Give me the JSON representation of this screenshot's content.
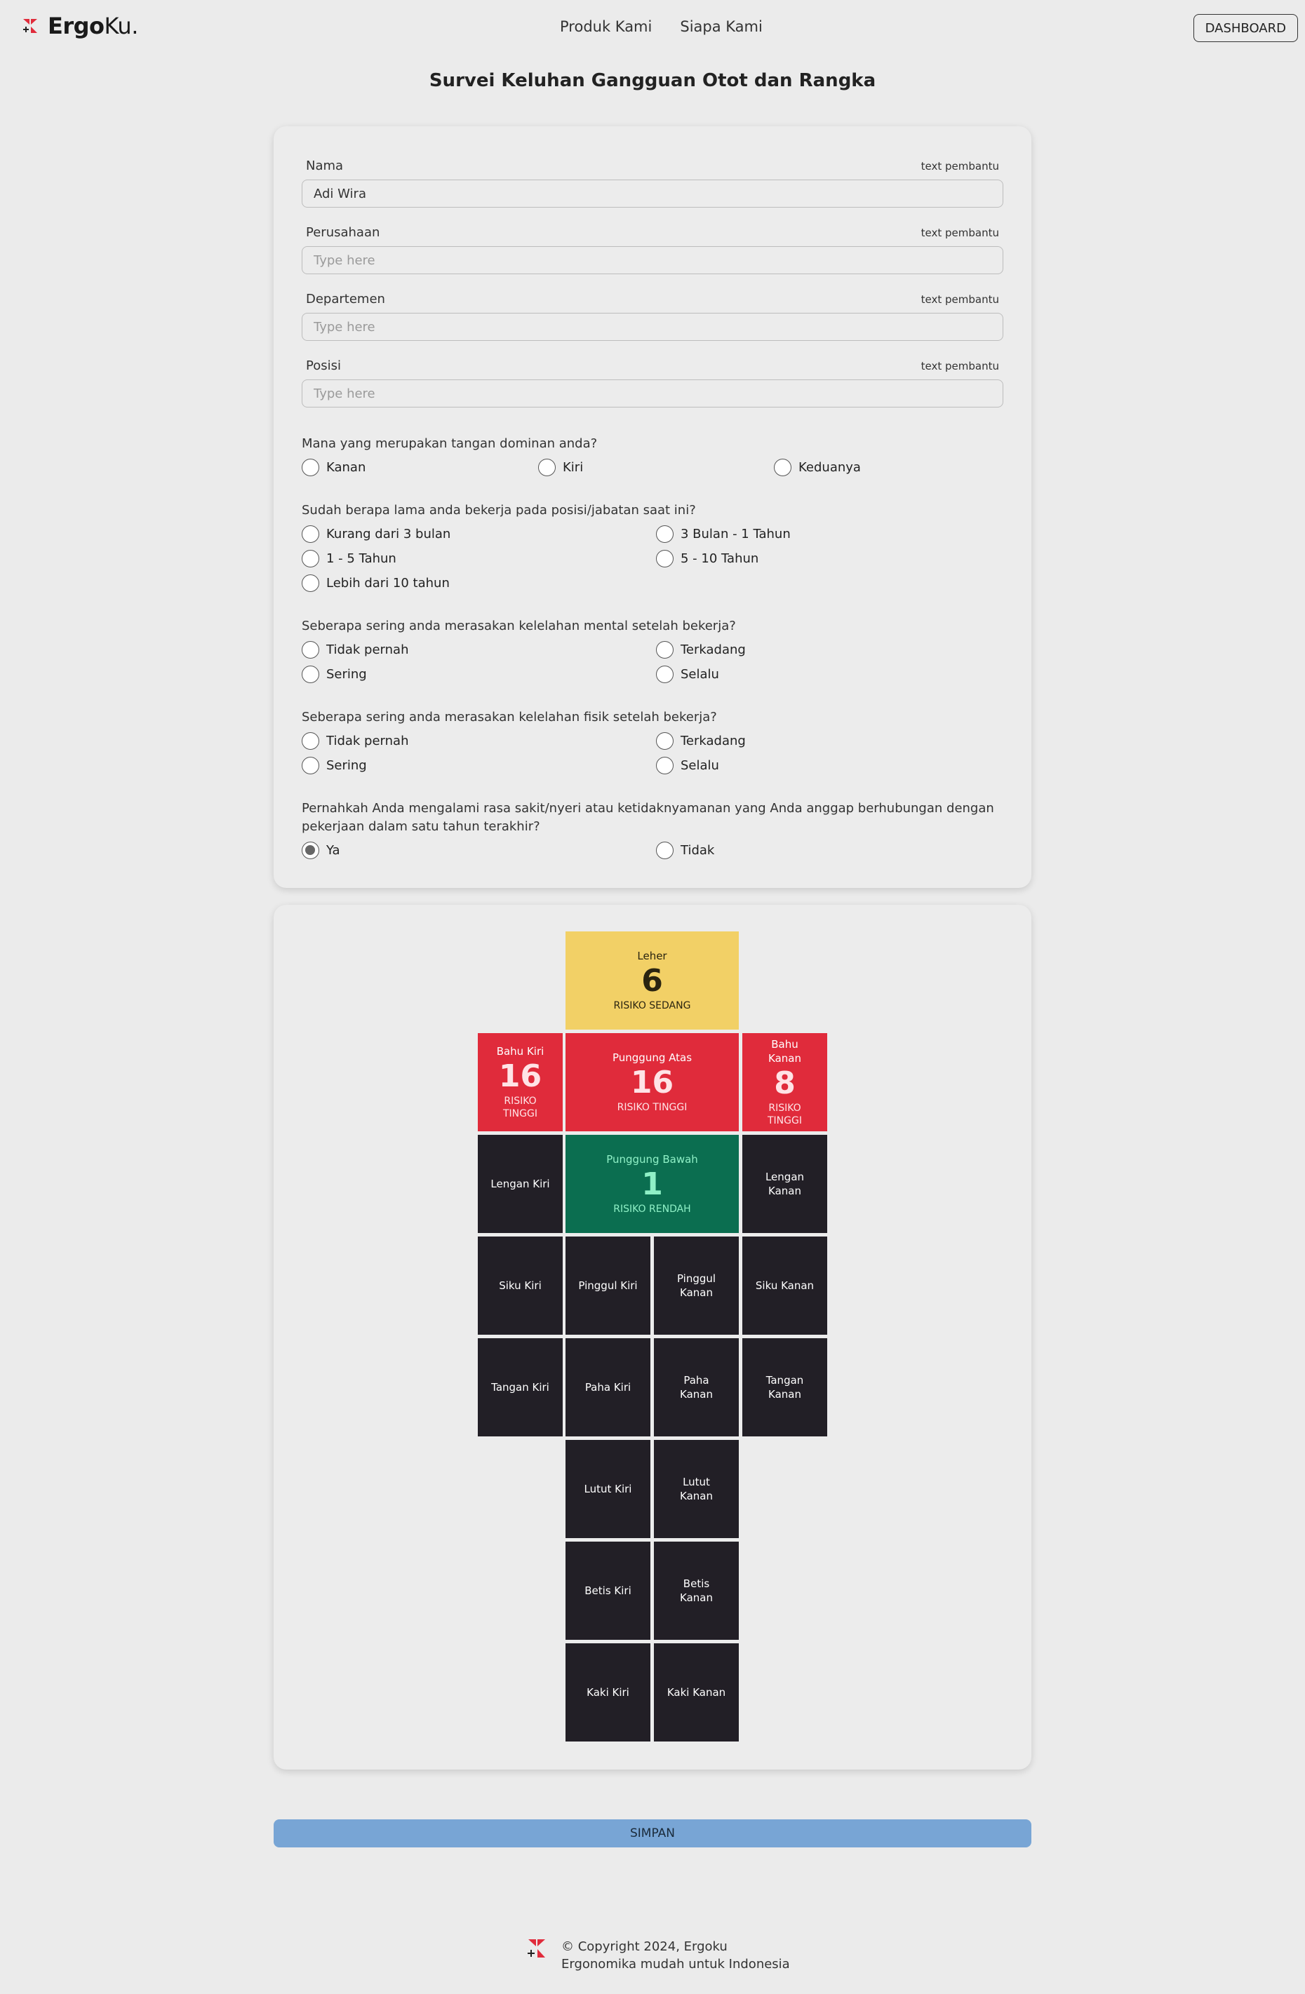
{
  "header": {
    "logo_bold": "Ergo",
    "logo_light": "Ku.",
    "nav": [
      "Produk Kami",
      "Siapa Kami"
    ],
    "dashboard_label": "DASHBOARD"
  },
  "title": "Survei Keluhan Gangguan Otot dan Rangka",
  "form": {
    "fields": [
      {
        "label": "Nama",
        "help": "text pembantu",
        "value": "Adi Wira",
        "placeholder": "Type here"
      },
      {
        "label": "Perusahaan",
        "help": "text pembantu",
        "value": "",
        "placeholder": "Type here"
      },
      {
        "label": "Departemen",
        "help": "text pembantu",
        "value": "",
        "placeholder": "Type here"
      },
      {
        "label": "Posisi",
        "help": "text pembantu",
        "value": "",
        "placeholder": "Type here"
      }
    ],
    "questions": [
      {
        "text": "Mana yang merupakan tangan dominan anda?",
        "options": [
          "Kanan",
          "Kiri",
          "Keduanya"
        ],
        "selected": null
      },
      {
        "text": "Sudah berapa lama anda bekerja pada posisi/jabatan saat ini?",
        "options": [
          "Kurang dari 3 bulan",
          "3 Bulan - 1 Tahun",
          "1 - 5 Tahun",
          "5 - 10 Tahun",
          "Lebih dari 10 tahun"
        ],
        "selected": null
      },
      {
        "text": "Seberapa sering anda merasakan kelelahan mental setelah bekerja?",
        "options": [
          "Tidak pernah",
          "Terkadang",
          "Sering",
          "Selalu"
        ],
        "selected": null
      },
      {
        "text": "Seberapa sering anda merasakan kelelahan fisik setelah bekerja?",
        "options": [
          "Tidak pernah",
          "Terkadang",
          "Sering",
          "Selalu"
        ],
        "selected": null
      },
      {
        "text": "Pernahkah Anda mengalami rasa sakit/nyeri atau ketidaknyamanan yang Anda anggap berhubungan dengan pekerjaan dalam satu tahun terakhir?",
        "options": [
          "Ya",
          "Tidak"
        ],
        "selected": "Ya"
      }
    ]
  },
  "body_map": {
    "cells": [
      {
        "name": "Leher",
        "score": "6",
        "risk": "RISIKO SEDANG",
        "level": "yellow"
      },
      {
        "name": "Bahu Kiri",
        "score": "16",
        "risk": "RISIKO TINGGI",
        "level": "red"
      },
      {
        "name": "Punggung Atas",
        "score": "16",
        "risk": "RISIKO TINGGI",
        "level": "red"
      },
      {
        "name": "Bahu Kanan",
        "score": "8",
        "risk": "RISIKO TINGGI",
        "level": "red"
      },
      {
        "name": "Lengan Kiri",
        "score": "",
        "risk": "",
        "level": "none"
      },
      {
        "name": "Punggung Bawah",
        "score": "1",
        "risk": "RISIKO RENDAH",
        "level": "green"
      },
      {
        "name": "Lengan Kanan",
        "score": "",
        "risk": "",
        "level": "none"
      },
      {
        "name": "Siku Kiri",
        "score": "",
        "risk": "",
        "level": "none"
      },
      {
        "name": "Pinggul Kiri",
        "score": "",
        "risk": "",
        "level": "none"
      },
      {
        "name": "Pinggul Kanan",
        "score": "",
        "risk": "",
        "level": "none"
      },
      {
        "name": "Siku Kanan",
        "score": "",
        "risk": "",
        "level": "none"
      },
      {
        "name": "Tangan Kiri",
        "score": "",
        "risk": "",
        "level": "none"
      },
      {
        "name": "Paha Kiri",
        "score": "",
        "risk": "",
        "level": "none"
      },
      {
        "name": "Paha Kanan",
        "score": "",
        "risk": "",
        "level": "none"
      },
      {
        "name": "Tangan Kanan",
        "score": "",
        "risk": "",
        "level": "none"
      },
      {
        "name": "Lutut Kiri",
        "score": "",
        "risk": "",
        "level": "none"
      },
      {
        "name": "Lutut Kanan",
        "score": "",
        "risk": "",
        "level": "none"
      },
      {
        "name": "Betis Kiri",
        "score": "",
        "risk": "",
        "level": "none"
      },
      {
        "name": "Betis Kanan",
        "score": "",
        "risk": "",
        "level": "none"
      },
      {
        "name": "Kaki Kiri",
        "score": "",
        "risk": "",
        "level": "none"
      },
      {
        "name": "Kaki Kanan",
        "score": "",
        "risk": "",
        "level": "none"
      }
    ]
  },
  "save_label": "SIMPAN",
  "footer": {
    "line1": "© Copyright 2024, Ergoku",
    "line2": "Ergonomika mudah untuk Indonesia"
  },
  "colors": {
    "red": "#e02b3b",
    "yellow": "#f2d066",
    "green": "#0b6e50",
    "dark": "#221f26",
    "save": "#78a5d5"
  }
}
